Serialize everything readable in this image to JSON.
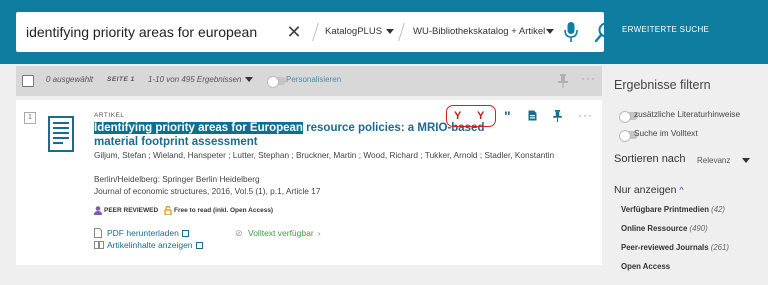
{
  "search": {
    "query": "identifying priority areas for european",
    "scope1": "KatalogPLUS",
    "scope2": "WU-Bibliothekskatalog + Artikel",
    "advanced": "ERWEITERTE SUCHE"
  },
  "results_bar": {
    "selected": "0 ausgewählt",
    "page": "SEITE 1",
    "range": "1-10 von 495 Ergebnissen",
    "personalize": "Personalisieren"
  },
  "result": {
    "number": "1",
    "type": "ARTIKEL",
    "title_highlight": "Identifying priority areas for European",
    "title_rest": " resource policies: a MRIO-based material footprint assessment",
    "authors": "Giljum, Stefan ; Wieland, Hanspeter ; Lutter, Stephan ; Bruckner, Martin ; Wood, Richard ; Tukker, Arnold ; Stadler, Konstantin",
    "publisher": "Berlin/Heidelberg: Springer Berlin Heidelberg",
    "journal": "Journal of economic structures, 2016, Vol.5 (1), p.1, Article 17",
    "badge_peer": "PEER REVIEWED",
    "badge_open": "Free to read (inkl. Open Access)",
    "link_pdf": "PDF herunterladen",
    "link_fulltext": "Volltext verfügbar",
    "link_contents": "Artikelinhalte anzeigen"
  },
  "sidebar": {
    "heading": "Ergebnisse filtern",
    "toggle1": "zusätzliche Literaturhinweise",
    "toggle2": "Suche im Volltext",
    "sort_label": "Sortieren nach",
    "sort_value": "Relevanz",
    "show_only": "Nur anzeigen",
    "facets": [
      {
        "label": "Verfügbare Printmedien",
        "count": "(42)"
      },
      {
        "label": "Online Ressource",
        "count": "(490)"
      },
      {
        "label": "Peer-reviewed Journals",
        "count": "(261)"
      },
      {
        "label": "Open Access",
        "count": ""
      }
    ]
  },
  "colors": {
    "brand": "#0f7da0",
    "link": "#1b6b8e",
    "highlight_ring": "#d02020",
    "fulltext_green": "#3f9b3f"
  }
}
